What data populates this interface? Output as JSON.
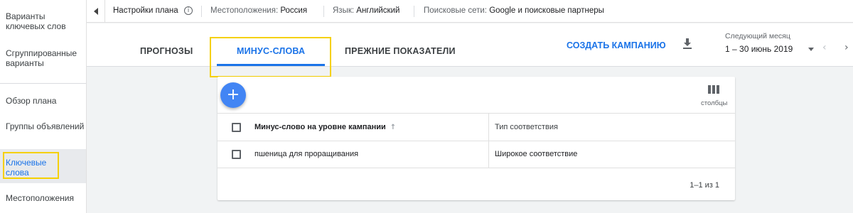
{
  "sidebar": {
    "items": [
      {
        "label": "Варианты ключевых слов"
      },
      {
        "label": "Сгруппированные варианты"
      },
      {
        "label": "Обзор плана"
      },
      {
        "label": "Группы объявлений"
      },
      {
        "label": "Ключевые слова"
      },
      {
        "label": "Местоположения"
      }
    ],
    "active_item": "Ключевые слова"
  },
  "topbar": {
    "plan_settings": "Настройки плана",
    "locations_label": "Местоположения:",
    "locations_value": "Россия",
    "language_label": "Язык:",
    "language_value": "Английский",
    "networks_label": "Поисковые сети:",
    "networks_value": "Google и поисковые партнеры"
  },
  "tabs": [
    {
      "label": "ПРОГНОЗЫ"
    },
    {
      "label": "МИНУС-СЛОВА",
      "active": true
    },
    {
      "label": "ПРЕЖНИЕ ПОКАЗАТЕЛИ"
    }
  ],
  "toolbar": {
    "create_campaign": "СОЗДАТЬ КАМПАНИЮ",
    "date_label": "Следующий месяц",
    "date_value": "1 – 30 июнь 2019"
  },
  "table": {
    "add_button": "+",
    "columns_label": "столбцы",
    "headers": [
      "Минус-слово на уровне кампании",
      "Тип соответствия"
    ],
    "rows": [
      [
        "пшеница для проращивания",
        "Широкое соответствие"
      ]
    ],
    "pagination": "1–1 из 1"
  },
  "colors": {
    "accent": "#1a73e8",
    "fab": "#4285f4",
    "highlight": "#f5d000"
  },
  "icons": [
    "info-icon",
    "collapse-left-icon",
    "download-icon",
    "dropdown-arrow-icon",
    "chevron-left-icon",
    "chevron-right-icon",
    "plus-icon",
    "columns-icon",
    "sort-ascending-icon"
  ]
}
